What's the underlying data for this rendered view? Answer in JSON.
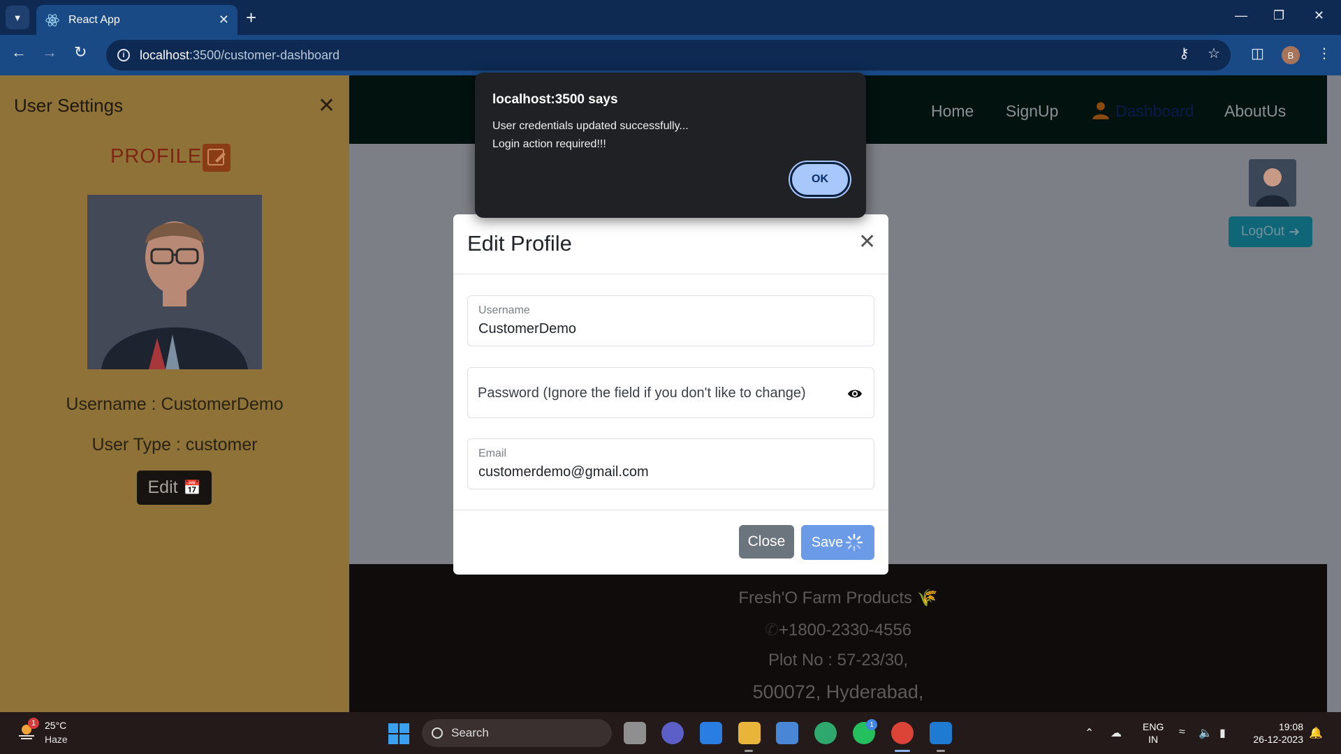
{
  "browser": {
    "tab_title": "React App",
    "url_host": "localhost",
    "url_rest": ":3500/customer-dashboard",
    "profile_initial": "B"
  },
  "navbar": {
    "links": [
      "Home",
      "SignUp",
      "Dashboard",
      "AboutUs"
    ]
  },
  "dashboard": {
    "logout_label": "LogOut"
  },
  "sidebar": {
    "title": "User Settings",
    "profile_heading": "PROFILE",
    "username_line": "Username : CustomerDemo",
    "usertype_line": "User Type : customer",
    "edit_label": "Edit"
  },
  "footer": {
    "brand": "Fresh'O Farm Products",
    "phone": "+1800-2330-4556",
    "address1": "Plot No : 57-23/30,",
    "address2": "500072, Hyderabad,"
  },
  "modal": {
    "title": "Edit Profile",
    "username_label": "Username",
    "username_value": "CustomerDemo",
    "password_placeholder": "Password (Ignore the field if you don't like to change)",
    "email_label": "Email",
    "email_value": "customerdemo@gmail.com",
    "close_label": "Close",
    "save_label": "Save"
  },
  "alert": {
    "title": "localhost:3500 says",
    "line1": "User credentials updated successfully...",
    "line2": "Login action required!!!",
    "ok_label": "OK"
  },
  "taskbar": {
    "weather_temp": "25°C",
    "weather_desc": "Haze",
    "weather_badge": "1",
    "search_label": "Search",
    "whatsapp_badge": "1",
    "lang_line1": "ENG",
    "lang_line2": "IN",
    "time": "19:08",
    "date": "26-12-2023"
  },
  "colors": {
    "sidebar_bg": "#8e7238",
    "browser_frame": "#0e2a52",
    "save_button": "#6b9be6",
    "close_button": "#6c757d",
    "alert_ok": "#a8c7fa"
  }
}
